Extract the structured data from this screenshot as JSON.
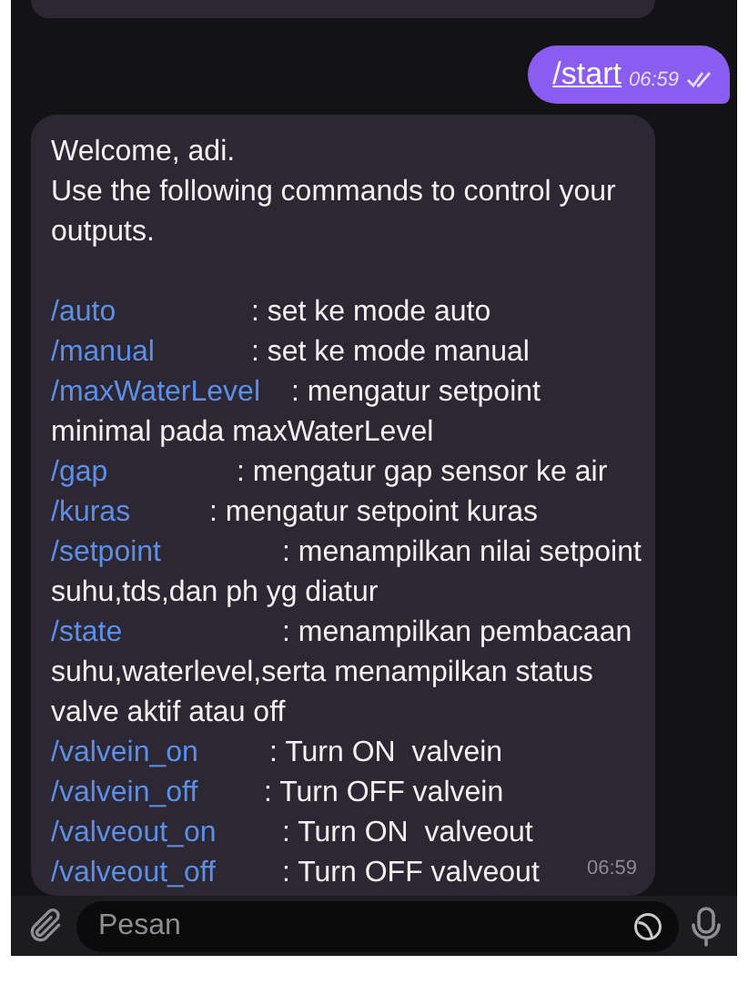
{
  "messages": [
    {
      "kind": "outgoing",
      "text": "/start",
      "time": "06:59",
      "read": true
    },
    {
      "kind": "incoming",
      "intro": [
        "Welcome, adi.",
        "Use the following commands to control your",
        "outputs."
      ],
      "commands": [
        {
          "command": "/auto",
          "description": ": set ke mode auto"
        },
        {
          "command": "/manual",
          "description": ": set ke mode manual"
        },
        {
          "command": "/maxWaterLevel",
          "description": ": mengatur setpoint",
          "continuation": [
            "minimal pada maxWaterLevel"
          ]
        },
        {
          "command": "/gap",
          "description": ": mengatur gap sensor ke air"
        },
        {
          "command": "/kuras",
          "description": ": mengatur setpoint kuras"
        },
        {
          "command": "/setpoint",
          "description": ": menampilkan nilai setpoint",
          "continuation": [
            "suhu,tds,dan ph yg diatur"
          ]
        },
        {
          "command": "/state",
          "description": ": menampilkan pembacaan",
          "continuation": [
            "suhu,waterlevel,serta menampilkan status",
            "valve aktif atau off"
          ]
        },
        {
          "command": "/valvein_on",
          "description": ": Turn ON  valvein"
        },
        {
          "command": "/valvein_off",
          "description": ": Turn OFF valvein"
        },
        {
          "command": "/valveout_on",
          "description": ": Turn ON  valveout"
        },
        {
          "command": "/valveout_off",
          "description": ": Turn OFF valveout"
        }
      ],
      "time": "06:59"
    }
  ],
  "composer": {
    "placeholder": "Pesan"
  }
}
